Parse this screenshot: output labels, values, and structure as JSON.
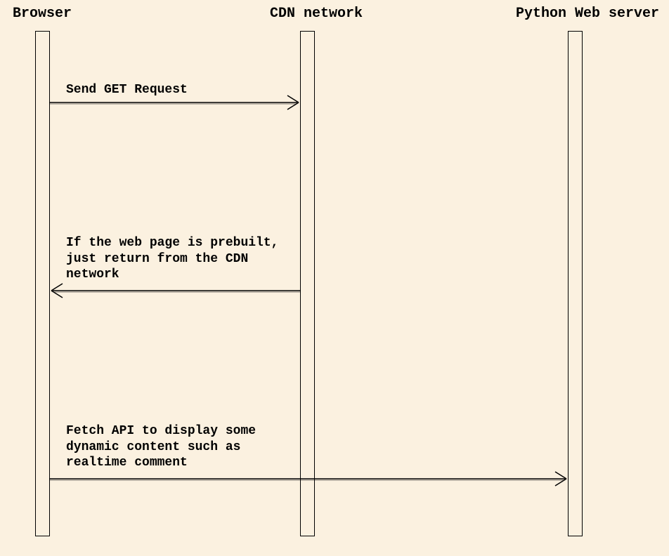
{
  "participants": [
    {
      "name": "Browser"
    },
    {
      "name": "CDN network"
    },
    {
      "name": "Python Web server"
    }
  ],
  "messages": [
    {
      "label": "Send GET Request"
    },
    {
      "label": "If the web page is prebuilt,\njust return from the CDN\nnetwork"
    },
    {
      "label": "Fetch API to display some\ndynamic content such as\nrealtime comment"
    }
  ]
}
